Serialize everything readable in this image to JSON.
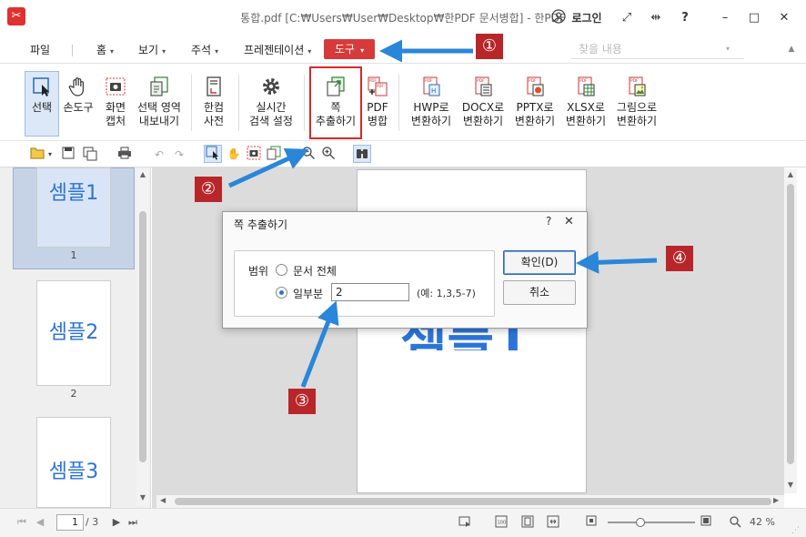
{
  "window": {
    "title": "통합.pdf [C:₩Users₩User₩Desktop₩한PDF 문서병합] - 한PDF",
    "login": "로그인",
    "help": "?",
    "minimize": "–",
    "maximize": "□",
    "close": "✕"
  },
  "menu": {
    "file": "파일",
    "home": "홈",
    "view": "보기",
    "annotate": "주석",
    "presentation": "프레젠테이션",
    "tools": "도구",
    "search_placeholder": "찾을 내용"
  },
  "ribbon": {
    "select": "선택",
    "hand": "손도구",
    "screen_capture": [
      "화면",
      "캡처"
    ],
    "export_area": [
      "선택 영역",
      "내보내기"
    ],
    "dictionary": [
      "한컴",
      "사전"
    ],
    "live_search": [
      "실시간",
      "검색 설정"
    ],
    "extract_pages": [
      "쪽",
      "추출하기"
    ],
    "pdf_merge": [
      "PDF",
      "병합"
    ],
    "to_hwp": [
      "HWP로",
      "변환하기"
    ],
    "to_docx": [
      "DOCX로",
      "변환하기"
    ],
    "to_pptx": [
      "PPTX로",
      "변환하기"
    ],
    "to_xlsx": [
      "XLSX로",
      "변환하기"
    ],
    "to_image": [
      "그림으로",
      "변환하기"
    ]
  },
  "thumbnails": [
    {
      "label": "셈플1",
      "page": "1"
    },
    {
      "label": "셈플2",
      "page": "2"
    },
    {
      "label": "셈플3",
      "page": ""
    }
  ],
  "page_content": "셈플1",
  "dialog": {
    "title": "쪽 추출하기",
    "help": "?",
    "close": "✕",
    "range_label": "범위",
    "option_all": "문서 전체",
    "option_partial": "일부분",
    "pages_value": "2",
    "example": "(예: 1,3,5-7)",
    "ok": "확인(D)",
    "cancel": "취소"
  },
  "status": {
    "current_page": "1",
    "total_pages": "/ 3",
    "zoom": "42 %",
    "zoom_level": 0.42
  },
  "annotations": [
    "①",
    "②",
    "③",
    "④"
  ],
  "colors": {
    "accent": "#d63a3a",
    "callout": "#b8262a",
    "arrow": "#2a86d8",
    "page_text": "#2b74d8"
  }
}
